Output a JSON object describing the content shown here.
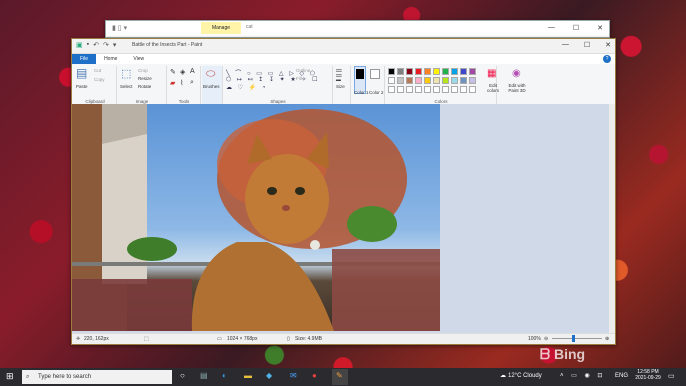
{
  "background_window": {
    "manage_label": "Manage",
    "path_text": "cat"
  },
  "paint": {
    "title": "Battle of the Insects Part - Paint",
    "tabs": [
      {
        "label": "File"
      },
      {
        "label": "Home"
      },
      {
        "label": "View"
      }
    ],
    "ribbon": {
      "clipboard": {
        "paste": "Paste",
        "cut": "Cut",
        "copy": "Copy",
        "label": "Clipboard"
      },
      "image": {
        "select": "Select",
        "crop": "Crop",
        "resize": "Resize",
        "rotate": "Rotate",
        "label": "Image"
      },
      "tools": {
        "label": "Tools",
        "brushes": "Brushes"
      },
      "shapes": {
        "outline": "Outline",
        "fill": "Fill",
        "label": "Shapes"
      },
      "size": "Size",
      "color1": "Color 1",
      "color2": "Color 2",
      "colors_label": "Colors",
      "edit_colors": "Edit colors",
      "edit_paint3d": "Edit with Paint 3D"
    },
    "palette": [
      "#000000",
      "#7f7f7f",
      "#880015",
      "#ed1c24",
      "#ff7f27",
      "#fff200",
      "#22b14c",
      "#00a2e8",
      "#3f48cc",
      "#a349a4",
      "#ffffff",
      "#c3c3c3",
      "#b97a57",
      "#ffaec9",
      "#ffc90e",
      "#efe4b0",
      "#b5e61d",
      "#99d9ea",
      "#7092be",
      "#c8bfe7"
    ],
    "status": {
      "cursor": "220, 162px",
      "dimensions": "1024 × 768px",
      "size": "Size: 4.9MB",
      "zoom": "100%"
    }
  },
  "taskbar": {
    "search_placeholder": "Type here to search",
    "weather": "12°C Cloudy",
    "lang": "ENG",
    "time": "12:58 PM",
    "date": "2021-09-29"
  },
  "watermark": "Bing"
}
